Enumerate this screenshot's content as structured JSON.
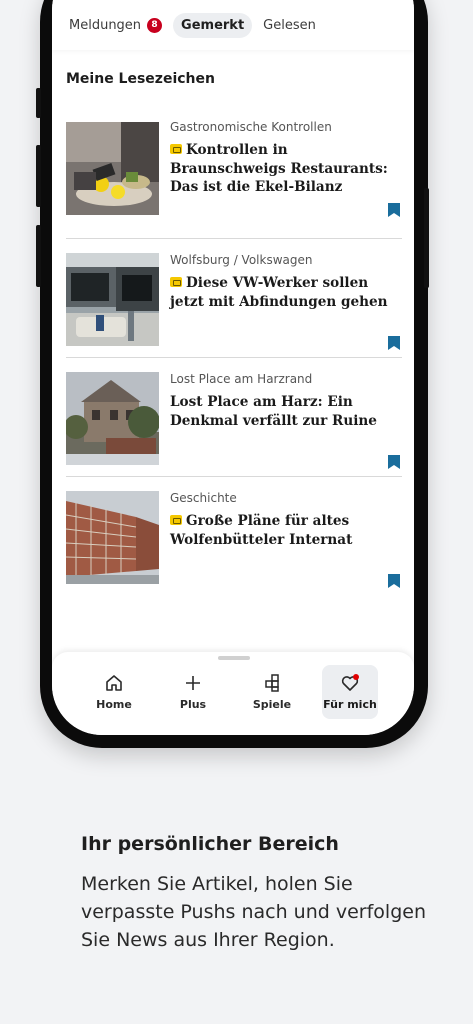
{
  "tabs": [
    {
      "label": "Meldungen",
      "badge": "8"
    },
    {
      "label": "Gemerkt",
      "active": true
    },
    {
      "label": "Gelesen"
    }
  ],
  "section_title": "Meine Lesezeichen",
  "articles": [
    {
      "kicker": "Gastronomische Kontrollen",
      "headline": "Kontrollen in Braunschweigs Restaurants: Das ist die Ekel-Bilanz",
      "plus": true,
      "image": "restaurant-kitchen-photo"
    },
    {
      "kicker": "Wolfsburg / Volkswagen",
      "headline": "Diese VW-Werker sollen jetzt mit Abfindungen gehen",
      "plus": true,
      "image": "car-factory-photo"
    },
    {
      "kicker": "Lost Place am Harzrand",
      "headline": "Lost Place am Harz: Ein Denkmal verfällt zur Ruine",
      "plus": false,
      "image": "ruined-house-photo"
    },
    {
      "kicker": "Geschichte",
      "headline": "Große Pläne für altes Wolfenbütteler Internat",
      "plus": true,
      "image": "scaffolded-building-photo"
    }
  ],
  "bottom_nav": [
    {
      "label": "Home",
      "icon": "home-icon"
    },
    {
      "label": "Plus",
      "icon": "plus-icon"
    },
    {
      "label": "Spiele",
      "icon": "puzzle-icon"
    },
    {
      "label": "Für mich",
      "icon": "heart-icon",
      "active": true
    }
  ],
  "promo": {
    "title": "Ihr persönlicher Bereich",
    "text": "Merken Sie Artikel, holen Sie verpasste Pushs nach und verfolgen Sie News aus Ihrer Region."
  },
  "colors": {
    "badge": "#c8001e",
    "plus_accent": "#f5c800",
    "bookmark": "#1a6d9c",
    "notification_dot": "#e00000"
  }
}
